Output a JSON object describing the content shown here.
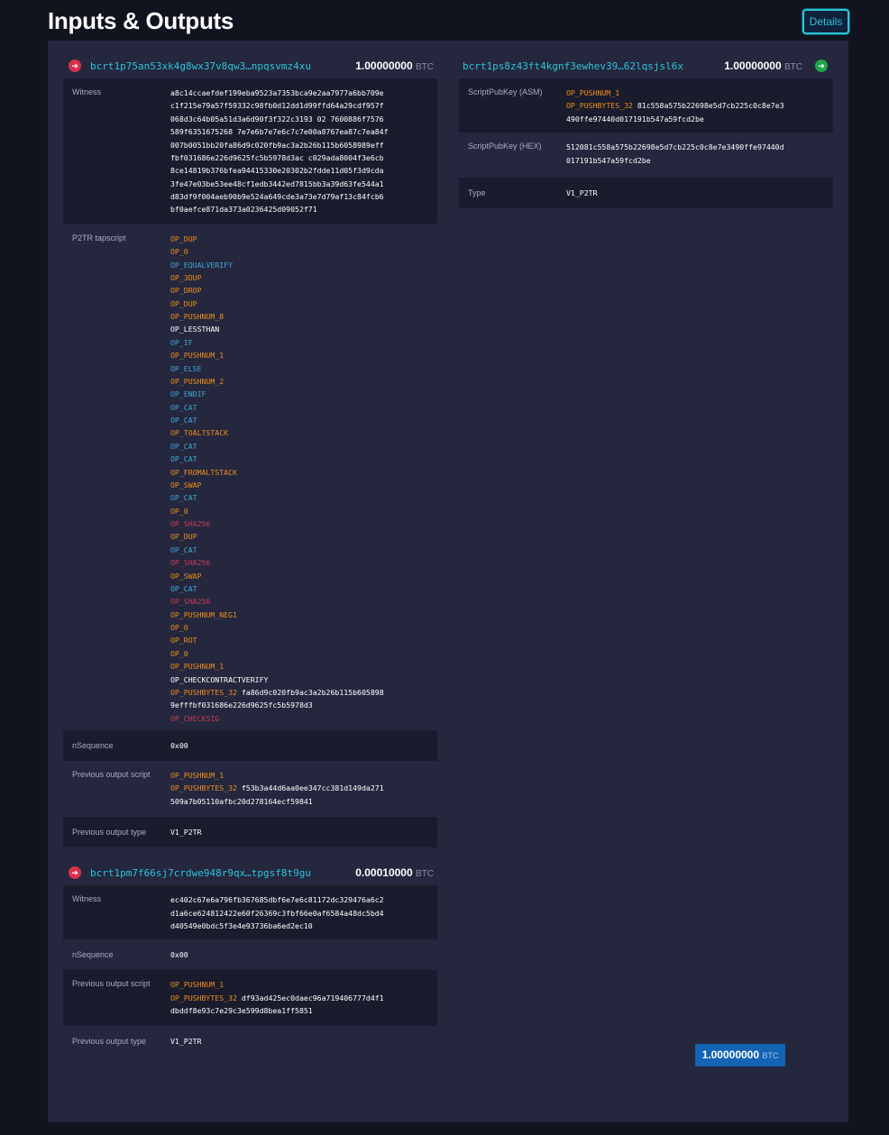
{
  "header": {
    "title": "Inputs & Outputs",
    "details_label": "Details"
  },
  "inputs": [
    {
      "address": "bcrt1p75an53xk4g8wx37v8qw3…npqsvmz4xu",
      "amount": "1.00000000",
      "unit": "BTC",
      "witness_label": "Witness",
      "witness_lines": [
        "a8c14ccaefdef199eba9523a7353bca9e2aa7977a6bb709e",
        "c1f215e79a57f59332c98fb0d12dd1d99ffd64a29cdf957f",
        "068d3c64b05a51d3a6d90f3f322c3193 02 7600886f7576",
        "589f6351675268 7e7e6b7e7e6c7c7e00a8767ea87c7ea84f",
        "007b0051bb20fa86d9c020fb9ac3a2b26b115b6058989eff",
        "fbf031686e226d9625fc5b5978d3ac c029ada8004f3e6cb",
        "8ce14819b376bfea94415330e20302b2fdde11d05f3d9cda",
        "3fe47e03be53ee48cf1edb3442ed7815bb3a39d63fe544a1",
        "d83df9f004aeb90b9e524a649cde3a73e7d79af13c84fcb6",
        "bf0aefce871da373a0236425d09052f71"
      ],
      "tapscript_label": "P2TR tapscript",
      "tapscript": [
        {
          "op": "OP_DUP",
          "c": "orange"
        },
        {
          "op": "OP_0",
          "c": "orange"
        },
        {
          "op": "OP_EQUALVERIFY",
          "c": "blue"
        },
        {
          "op": "OP_3DUP",
          "c": "orange"
        },
        {
          "op": "OP_DROP",
          "c": "orange"
        },
        {
          "op": "OP_DUP",
          "c": "orange"
        },
        {
          "op": "OP_PUSHNUM_8",
          "c": "orange"
        },
        {
          "op": "OP_LESSTHAN",
          "c": "white"
        },
        {
          "op": "OP_IF",
          "c": "blue"
        },
        {
          "op": "OP_PUSHNUM_1",
          "c": "orange"
        },
        {
          "op": "OP_ELSE",
          "c": "blue"
        },
        {
          "op": "OP_PUSHNUM_2",
          "c": "orange"
        },
        {
          "op": "OP_ENDIF",
          "c": "blue"
        },
        {
          "op": "OP_CAT",
          "c": "blue"
        },
        {
          "op": "OP_CAT",
          "c": "blue"
        },
        {
          "op": "OP_TOALTSTACK",
          "c": "orange"
        },
        {
          "op": "OP_CAT",
          "c": "blue"
        },
        {
          "op": "OP_CAT",
          "c": "blue"
        },
        {
          "op": "OP_FROMALTSTACK",
          "c": "orange"
        },
        {
          "op": "OP_SWAP",
          "c": "orange"
        },
        {
          "op": "OP_CAT",
          "c": "blue"
        },
        {
          "op": "OP_0",
          "c": "orange"
        },
        {
          "op": "OP_SHA256",
          "c": "red"
        },
        {
          "op": "OP_DUP",
          "c": "orange"
        },
        {
          "op": "OP_CAT",
          "c": "blue"
        },
        {
          "op": "OP_SHA256",
          "c": "red"
        },
        {
          "op": "OP_SWAP",
          "c": "orange"
        },
        {
          "op": "OP_CAT",
          "c": "blue"
        },
        {
          "op": "OP_SHA256",
          "c": "red"
        },
        {
          "op": "OP_PUSHNUM_NEG1",
          "c": "orange"
        },
        {
          "op": "OP_0",
          "c": "orange"
        },
        {
          "op": "OP_ROT",
          "c": "orange"
        },
        {
          "op": "OP_0",
          "c": "orange"
        },
        {
          "op": "OP_PUSHNUM_1",
          "c": "orange"
        },
        {
          "op": "OP_CHECKCONTRACTVERIFY",
          "c": "white"
        },
        {
          "op": "OP_PUSHBYTES_32",
          "c": "orange",
          "arg": "fa86d9c020fb9ac3a2b26b115b605898"
        },
        {
          "op": "",
          "c": "white",
          "arg": "9efffbf031686e226d9625fc5b5978d3"
        },
        {
          "op": "OP_CHECKSIG",
          "c": "red"
        }
      ],
      "nsequence_label": "nSequence",
      "nsequence": "0x00",
      "prevout_script_label": "Previous output script",
      "prevout_script": [
        {
          "op": "OP_PUSHNUM_1",
          "c": "orange"
        },
        {
          "op": "OP_PUSHBYTES_32",
          "c": "orange",
          "arg": "f53b3a44d6aa0ee347cc381d149da271"
        },
        {
          "op": "",
          "c": "white",
          "arg": "509a7b05110afbc20d278164ecf59841"
        }
      ],
      "prevout_type_label": "Previous output type",
      "prevout_type": "V1_P2TR"
    },
    {
      "address": "bcrt1pm7f66sj7crdwe948r9qx…tpgsf8t9gu",
      "amount": "0.00010000",
      "unit": "BTC",
      "witness_label": "Witness",
      "witness_lines": [
        "ec402c67e6a796fb367685dbf6e7e6c81172dc329476a6c2",
        "d1a6ce624812422e60f26369c3fbf66e0af6584a48dc5bd4",
        "d40549e0bdc5f3e4e93736ba6ed2ec10"
      ],
      "nsequence_label": "nSequence",
      "nsequence": "0x00",
      "prevout_script_label": "Previous output script",
      "prevout_script": [
        {
          "op": "OP_PUSHNUM_1",
          "c": "orange"
        },
        {
          "op": "OP_PUSHBYTES_32",
          "c": "orange",
          "arg": "df93ad425ec0daec96a719406777d4f1"
        },
        {
          "op": "",
          "c": "white",
          "arg": "dbddf8e93c7e29c3e599d8bea1ff5851"
        }
      ],
      "prevout_type_label": "Previous output type",
      "prevout_type": "V1_P2TR"
    }
  ],
  "output": {
    "address": "bcrt1ps8z43ft4kgnf3ewhev39…62lqsjsl6x",
    "amount": "1.00000000",
    "unit": "BTC",
    "asm_label": "ScriptPubKey (ASM)",
    "asm": [
      {
        "op": "OP_PUSHNUM_1",
        "c": "orange"
      },
      {
        "op": "OP_PUSHBYTES_32",
        "c": "orange",
        "arg": "81c558a575b22698e5d7cb225c0c8e7e3"
      },
      {
        "op": "",
        "c": "white",
        "arg": "490ffe97440d017191b547a59fcd2be"
      }
    ],
    "hex_label": "ScriptPubKey (HEX)",
    "hex_lines": [
      "512081c558a575b22698e5d7cb225c0c8e7e3490ffe97440d",
      "017191b547a59fcd2be"
    ],
    "type_label": "Type",
    "type": "V1_P2TR"
  },
  "total": {
    "amount": "1.00000000",
    "unit": "BTC"
  },
  "icons": {
    "input": "arrow-right-circle-red-icon",
    "output": "arrow-right-circle-green-icon"
  },
  "colors": {
    "accent": "#2ec4d8",
    "op_orange": "#ef8e1b",
    "op_blue": "#42a7d6",
    "op_red": "#c93c52",
    "total_bg": "#1364b3"
  }
}
